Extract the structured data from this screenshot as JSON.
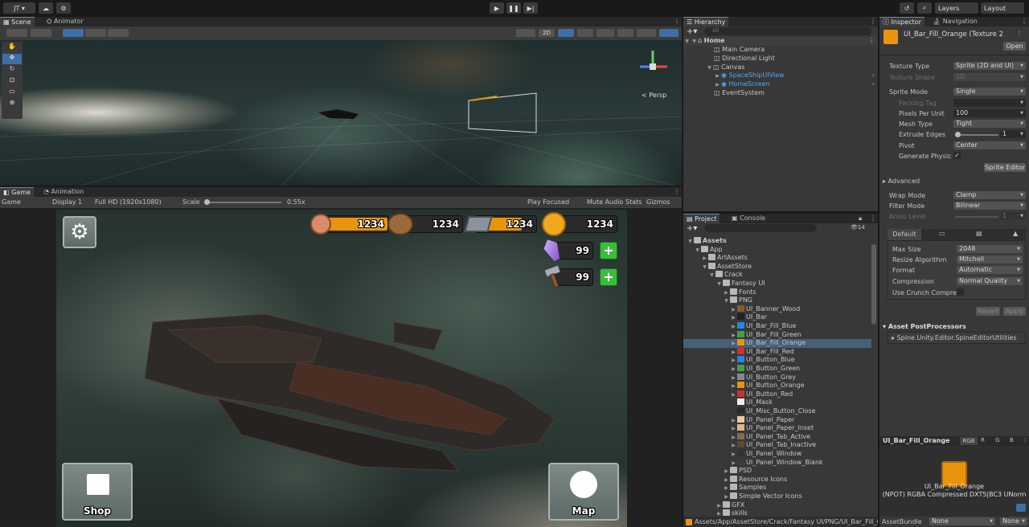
{
  "topbar": {
    "account": "JT",
    "layers": "Layers",
    "layout": "Layout"
  },
  "scene_tabs": {
    "scene": "Scene",
    "animator": "Animator",
    "mode_2d": "2D",
    "persp": "< Persp"
  },
  "game_tabs": {
    "game": "Game",
    "animation": "Animation"
  },
  "game_toolbar": {
    "mode": "Game",
    "display": "Display 1",
    "resolution": "Full HD (1920x1080)",
    "scale_label": "Scale",
    "scale_value": "0.55x",
    "play_focused": "Play Focused",
    "mute": "Mute Audio",
    "stats": "Stats",
    "gizmos": "Gizmos"
  },
  "game_ui": {
    "res1": "1234",
    "res2": "1234",
    "res3": "1234",
    "res4": "1234",
    "gems": "99",
    "hammers": "99",
    "shop": "Shop",
    "map": "Map"
  },
  "hierarchy": {
    "title": "Hierarchy",
    "search": "All",
    "items": [
      "Home",
      "Main Camera",
      "Directional Light",
      "Canvas",
      "SpaceShipUIView",
      "HomeScreen",
      "EventSystem"
    ]
  },
  "project": {
    "tab_project": "Project",
    "tab_console": "Console",
    "count": "14",
    "items": [
      "Assets",
      "App",
      "ArtAssets",
      "AssetStore",
      "Crack",
      "Fantasy UI",
      "Fonts",
      "PNG",
      "UI_Banner_Wood",
      "UI_Bar",
      "UI_Bar_Fill_Blue",
      "UI_Bar_Fill_Green",
      "UI_Bar_Fill_Orange",
      "UI_Bar_Fill_Red",
      "UI_Button_Blue",
      "UI_Button_Green",
      "UI_Button_Grey",
      "UI_Button_Orange",
      "UI_Button_Red",
      "UI_Mask",
      "UI_Misc_Button_Close",
      "UI_Panel_Paper",
      "UI_Panel_Paper_Inset",
      "UI_Panel_Tab_Active",
      "UI_Panel_Tab_Inactive",
      "UI_Panel_Window",
      "UI_Panel_Window_Blank",
      "PSD",
      "Resource Icons",
      "Samples",
      "Simple Vector Icons",
      "GFX",
      "skills"
    ],
    "path": "Assets/App/AssetStore/Crack/Fantasy UI/PNG/UI_Bar_Fill_Or"
  },
  "inspector": {
    "tab_inspector": "Inspector",
    "tab_navigation": "Navigation",
    "asset_name": "UI_Bar_Fill_Orange (Texture 2",
    "open": "Open",
    "texture_type_label": "Texture Type",
    "texture_type": "Sprite (2D and UI)",
    "texture_shape_label": "Texture Shape",
    "texture_shape": "2D",
    "sprite_mode_label": "Sprite Mode",
    "sprite_mode": "Single",
    "packing_tag_label": "Packing Tag",
    "ppu_label": "Pixels Per Unit",
    "ppu": "100",
    "mesh_type_label": "Mesh Type",
    "mesh_type": "Tight",
    "extrude_label": "Extrude Edges",
    "extrude": "1",
    "pivot_label": "Pivot",
    "pivot": "Center",
    "gen_physics_label": "Generate Physics Sh",
    "sprite_editor": "Sprite Editor",
    "advanced": "Advanced",
    "wrap_label": "Wrap Mode",
    "wrap": "Clamp",
    "filter_label": "Filter Mode",
    "filter": "Bilinear",
    "aniso_label": "Aniso Level",
    "aniso": "1",
    "platform_default": "Default",
    "max_size_label": "Max Size",
    "max_size": "2048",
    "resize_label": "Resize Algorithm",
    "resize": "Mitchell",
    "format_label": "Format",
    "format": "Automatic",
    "compression_label": "Compression",
    "compression": "Normal Quality",
    "crunch_label": "Use Crunch Compres",
    "revert": "Revert",
    "apply": "Apply",
    "postprocessors": "Asset PostProcessors",
    "postprocessor_item": "Spine.Unity.Editor.SpineEditorUtilities",
    "preview_name": "UI_Bar_Fill_Orange",
    "preview_rgb": "RGB",
    "preview_r": "R",
    "preview_g": "G",
    "preview_b": "B",
    "preview_caption1": "UI_Bar_Fill_Orange",
    "preview_caption2": "(NPOT)  RGBA Compressed DXT5|BC3 UNorm",
    "assetbundle_label": "AssetBundle",
    "assetbundle": "None",
    "variant": "None"
  },
  "colors": {
    "accent": "#4a8ed8",
    "orange": "#e8940c",
    "selection": "#46607c"
  }
}
